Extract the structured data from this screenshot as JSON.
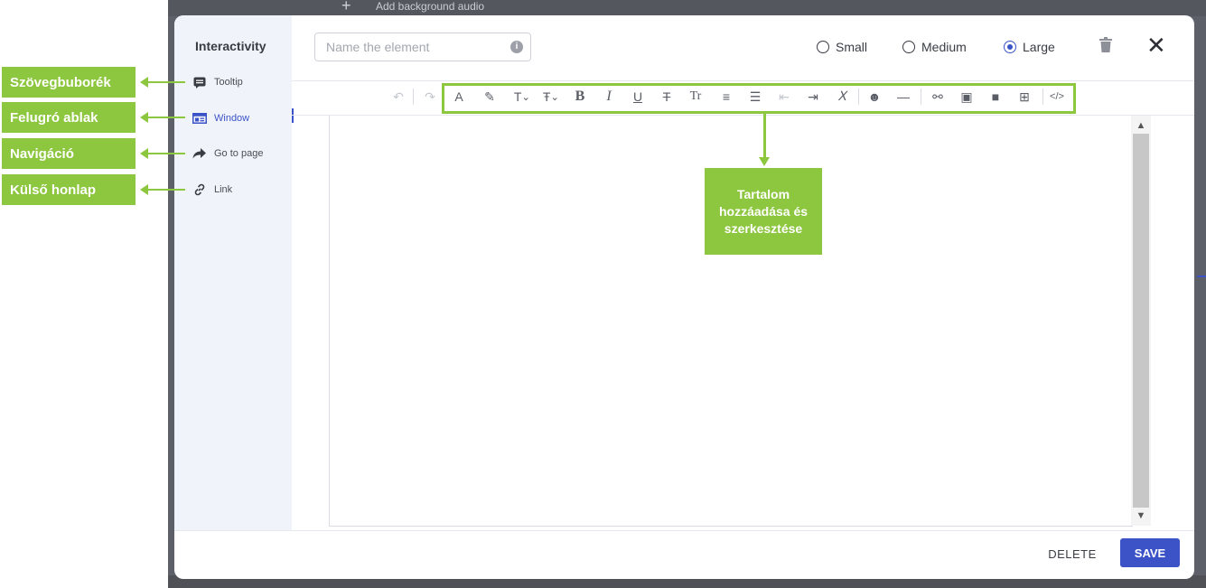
{
  "background": {
    "label": "Add background audio"
  },
  "sidebar": {
    "title": "Interactivity",
    "items": [
      {
        "label": "Tooltip",
        "icon": "tooltip-icon"
      },
      {
        "label": "Window",
        "icon": "window-icon",
        "active": true
      },
      {
        "label": "Go to page",
        "icon": "arrow-right-icon"
      },
      {
        "label": "Link",
        "icon": "link-icon"
      }
    ]
  },
  "header": {
    "name_placeholder": "Name the element",
    "name_value": "",
    "sizes": [
      {
        "label": "Small",
        "checked": false
      },
      {
        "label": "Medium",
        "checked": false
      },
      {
        "label": "Large",
        "checked": true
      }
    ]
  },
  "toolbar": {
    "buttons": [
      "undo",
      "redo",
      "font-color",
      "highlight",
      "font-size",
      "strikethrough-size",
      "bold",
      "italic",
      "underline",
      "strikethrough",
      "text-case",
      "align",
      "list",
      "outdent",
      "indent",
      "clear-format",
      "emoji",
      "horizontal-rule",
      "link",
      "image",
      "video",
      "table",
      "code"
    ]
  },
  "footer": {
    "delete_label": "DELETE",
    "save_label": "SAVE"
  },
  "annotations": {
    "labels": [
      "Szövegbuborék",
      "Felugró ablak",
      "Navigáció",
      "Külső honlap"
    ],
    "callout": "Tartalom hozzáadása és szerkesztése"
  },
  "colors": {
    "accent": "#3b53c6",
    "annotation": "#8dc63f",
    "sidebar_bg": "#f1f3fa"
  }
}
